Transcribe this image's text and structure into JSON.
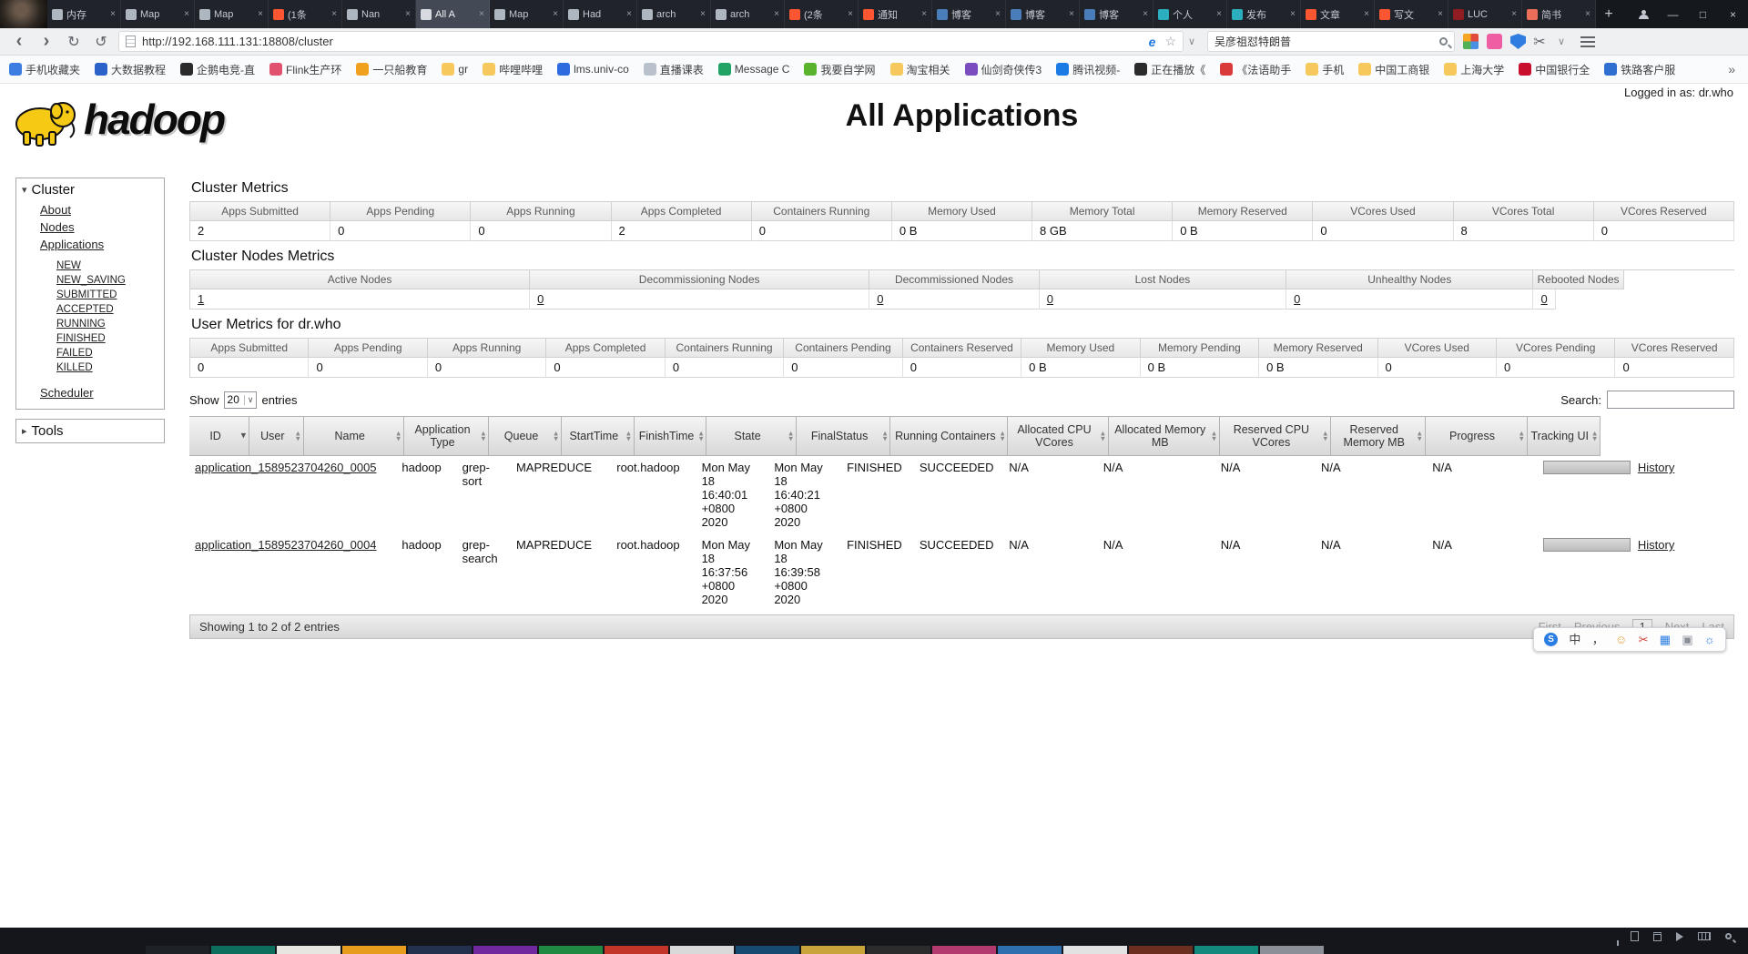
{
  "icons": {
    "close": "×",
    "plus": "+",
    "minimize": "—",
    "maximize": "□",
    "back": "‹",
    "forward": "›",
    "refresh": "↻",
    "undo": "↺",
    "star": "☆",
    "chevron": "∨",
    "scissors": "✂",
    "e": "e",
    "overflow": "»",
    "tri_down": "▾",
    "tri_right": "▸",
    "sort_up": "▴",
    "sort_down": "▾",
    "smiley": "☺",
    "keyboard": "▦",
    "toolbox": "▣",
    "gear": "☼",
    "chinese": "中",
    "punct": "，",
    "sogou": "S"
  },
  "browser": {
    "url": "http://192.168.111.131:18808/cluster",
    "search_query": "吴彦祖怼特朗普",
    "tabs": [
      {
        "title": "内存",
        "color": "#aeb6bf"
      },
      {
        "title": "Map",
        "color": "#aeb6bf"
      },
      {
        "title": "Map",
        "color": "#aeb6bf"
      },
      {
        "title": "(1条",
        "color": "#fc5531"
      },
      {
        "title": "Nan",
        "color": "#aeb6bf"
      },
      {
        "title": "All A",
        "color": "#d7dade",
        "active": true
      },
      {
        "title": "Map",
        "color": "#aeb6bf"
      },
      {
        "title": "Had",
        "color": "#aeb6bf"
      },
      {
        "title": "arch",
        "color": "#aeb6bf"
      },
      {
        "title": "arch",
        "color": "#aeb6bf"
      },
      {
        "title": "(2条",
        "color": "#fc5531"
      },
      {
        "title": "通知",
        "color": "#fc5531"
      },
      {
        "title": "博客",
        "color": "#4a7ebb"
      },
      {
        "title": "博客",
        "color": "#4a7ebb"
      },
      {
        "title": "博客",
        "color": "#4a7ebb"
      },
      {
        "title": "个人",
        "color": "#2bafbf"
      },
      {
        "title": "发布",
        "color": "#2bafbf"
      },
      {
        "title": "文章",
        "color": "#fc5531"
      },
      {
        "title": "写文",
        "color": "#fc5531"
      },
      {
        "title": "LUC",
        "color": "#8f1d21"
      },
      {
        "title": "简书",
        "color": "#ea6f5a"
      }
    ],
    "bookmarks": [
      {
        "label": "手机收藏夹",
        "color": "#3b7de0"
      },
      {
        "label": "大数据教程",
        "color": "#2a62c9"
      },
      {
        "label": "企鹅电竞-直",
        "color": "#2b2b2b"
      },
      {
        "label": "Flink生产环",
        "color": "#e0526e"
      },
      {
        "label": "一只船教育",
        "color": "#f0a11e"
      },
      {
        "label": "gr",
        "color": "#f7c85c"
      },
      {
        "label": "哔哩哔哩",
        "color": "#f7c85c"
      },
      {
        "label": "lms.univ-co",
        "color": "#2d6cdf"
      },
      {
        "label": "直播课表",
        "color": "#b9c2cc"
      },
      {
        "label": "Message C",
        "color": "#21a366"
      },
      {
        "label": "我要自学网",
        "color": "#59b32d"
      },
      {
        "label": "淘宝相关",
        "color": "#f7c85c"
      },
      {
        "label": "仙剑奇侠传3",
        "color": "#7a4dbf"
      },
      {
        "label": "腾讯视频-",
        "color": "#1b7be5"
      },
      {
        "label": "正在播放《",
        "color": "#2b2b2b"
      },
      {
        "label": "《法语助手",
        "color": "#d93a3a"
      },
      {
        "label": "手机",
        "color": "#f7c85c"
      },
      {
        "label": "中国工商银",
        "color": "#f7c85c"
      },
      {
        "label": "上海大学",
        "color": "#f7c85c"
      },
      {
        "label": "中国银行全",
        "color": "#c8102e"
      },
      {
        "label": "铁路客户服",
        "color": "#2f6fd0"
      }
    ]
  },
  "page": {
    "logo_text": "hadoop",
    "title": "All Applications",
    "logged_in": "Logged in as: dr.who",
    "sidebar": {
      "cluster": "Cluster",
      "links": [
        "About",
        "Nodes",
        "Applications"
      ],
      "states": [
        "NEW",
        "NEW_SAVING",
        "SUBMITTED",
        "ACCEPTED",
        "RUNNING",
        "FINISHED",
        "FAILED",
        "KILLED"
      ],
      "scheduler": "Scheduler",
      "tools": "Tools"
    },
    "cluster_metrics": {
      "title": "Cluster Metrics",
      "headers": [
        "Apps Submitted",
        "Apps Pending",
        "Apps Running",
        "Apps Completed",
        "Containers Running",
        "Memory Used",
        "Memory Total",
        "Memory Reserved",
        "VCores Used",
        "VCores Total",
        "VCores Reserved"
      ],
      "values": [
        "2",
        "0",
        "0",
        "2",
        "0",
        "0 B",
        "8 GB",
        "0 B",
        "0",
        "8",
        "0"
      ]
    },
    "nodes_metrics": {
      "title": "Cluster Nodes Metrics",
      "headers": [
        "Active Nodes",
        "Decommissioning Nodes",
        "Decommissioned Nodes",
        "Lost Nodes",
        "Unhealthy Nodes",
        "Rebooted Nodes"
      ],
      "values": [
        "1",
        "0",
        "0",
        "0",
        "0",
        "0"
      ]
    },
    "user_metrics": {
      "title": "User Metrics for dr.who",
      "headers": [
        "Apps Submitted",
        "Apps Pending",
        "Apps Running",
        "Apps Completed",
        "Containers Running",
        "Containers Pending",
        "Containers Reserved",
        "Memory Used",
        "Memory Pending",
        "Memory Reserved",
        "VCores Used",
        "VCores Pending",
        "VCores Reserved"
      ],
      "values": [
        "0",
        "0",
        "0",
        "0",
        "0",
        "0",
        "0",
        "0 B",
        "0 B",
        "0 B",
        "0",
        "0",
        "0"
      ]
    },
    "controls": {
      "show": "Show",
      "page_size": "20",
      "entries": "entries",
      "search_label": "Search:",
      "search_value": ""
    },
    "apps": {
      "headers": [
        {
          "label": "ID",
          "sorted": true
        },
        {
          "label": "User"
        },
        {
          "label": "Name"
        },
        {
          "label": "Application Type"
        },
        {
          "label": "Queue"
        },
        {
          "label": "StartTime"
        },
        {
          "label": "FinishTime"
        },
        {
          "label": "State"
        },
        {
          "label": "FinalStatus"
        },
        {
          "label": "Running Containers"
        },
        {
          "label": "Allocated CPU VCores"
        },
        {
          "label": "Allocated Memory MB"
        },
        {
          "label": "Reserved CPU VCores"
        },
        {
          "label": "Reserved Memory MB"
        },
        {
          "label": "Progress"
        },
        {
          "label": "Tracking UI"
        }
      ],
      "rows": [
        {
          "id": "application_1589523704260_0005",
          "user": "hadoop",
          "name": "grep-sort",
          "type": "MAPREDUCE",
          "queue": "root.hadoop",
          "start": "Mon May 18 16:40:01 +0800 2020",
          "finish": "Mon May 18 16:40:21 +0800 2020",
          "state": "FINISHED",
          "final": "SUCCEEDED",
          "containers": "N/A",
          "alloc_vcores": "N/A",
          "alloc_mem": "N/A",
          "res_vcores": "N/A",
          "res_mem": "N/A",
          "progress": 100,
          "tracking": "History"
        },
        {
          "id": "application_1589523704260_0004",
          "user": "hadoop",
          "name": "grep-search",
          "type": "MAPREDUCE",
          "queue": "root.hadoop",
          "start": "Mon May 18 16:37:56 +0800 2020",
          "finish": "Mon May 18 16:39:58 +0800 2020",
          "state": "FINISHED",
          "final": "SUCCEEDED",
          "containers": "N/A",
          "alloc_vcores": "N/A",
          "alloc_mem": "N/A",
          "res_vcores": "N/A",
          "res_mem": "N/A",
          "progress": 100,
          "tracking": "History"
        }
      ]
    },
    "footer": {
      "info": "Showing 1 to 2 of 2 entries",
      "pages": [
        {
          "label": "First"
        },
        {
          "label": "Previous"
        },
        {
          "label": "1",
          "current": true
        },
        {
          "label": "Next"
        },
        {
          "label": "Last"
        }
      ]
    }
  },
  "taskbar": {
    "thumbnails": [
      "#1e2126",
      "#0e6e5e",
      "#e8e6e0",
      "#e89c1e",
      "#23304e",
      "#71279e",
      "#1e8a42",
      "#c23528",
      "#d9d9d9",
      "#174a70",
      "#c9a43a",
      "#2c2c2c",
      "#b23a6e",
      "#2e6fb0",
      "#e2e2e2",
      "#6b2f20",
      "#12897a",
      "#8a8f98"
    ]
  }
}
